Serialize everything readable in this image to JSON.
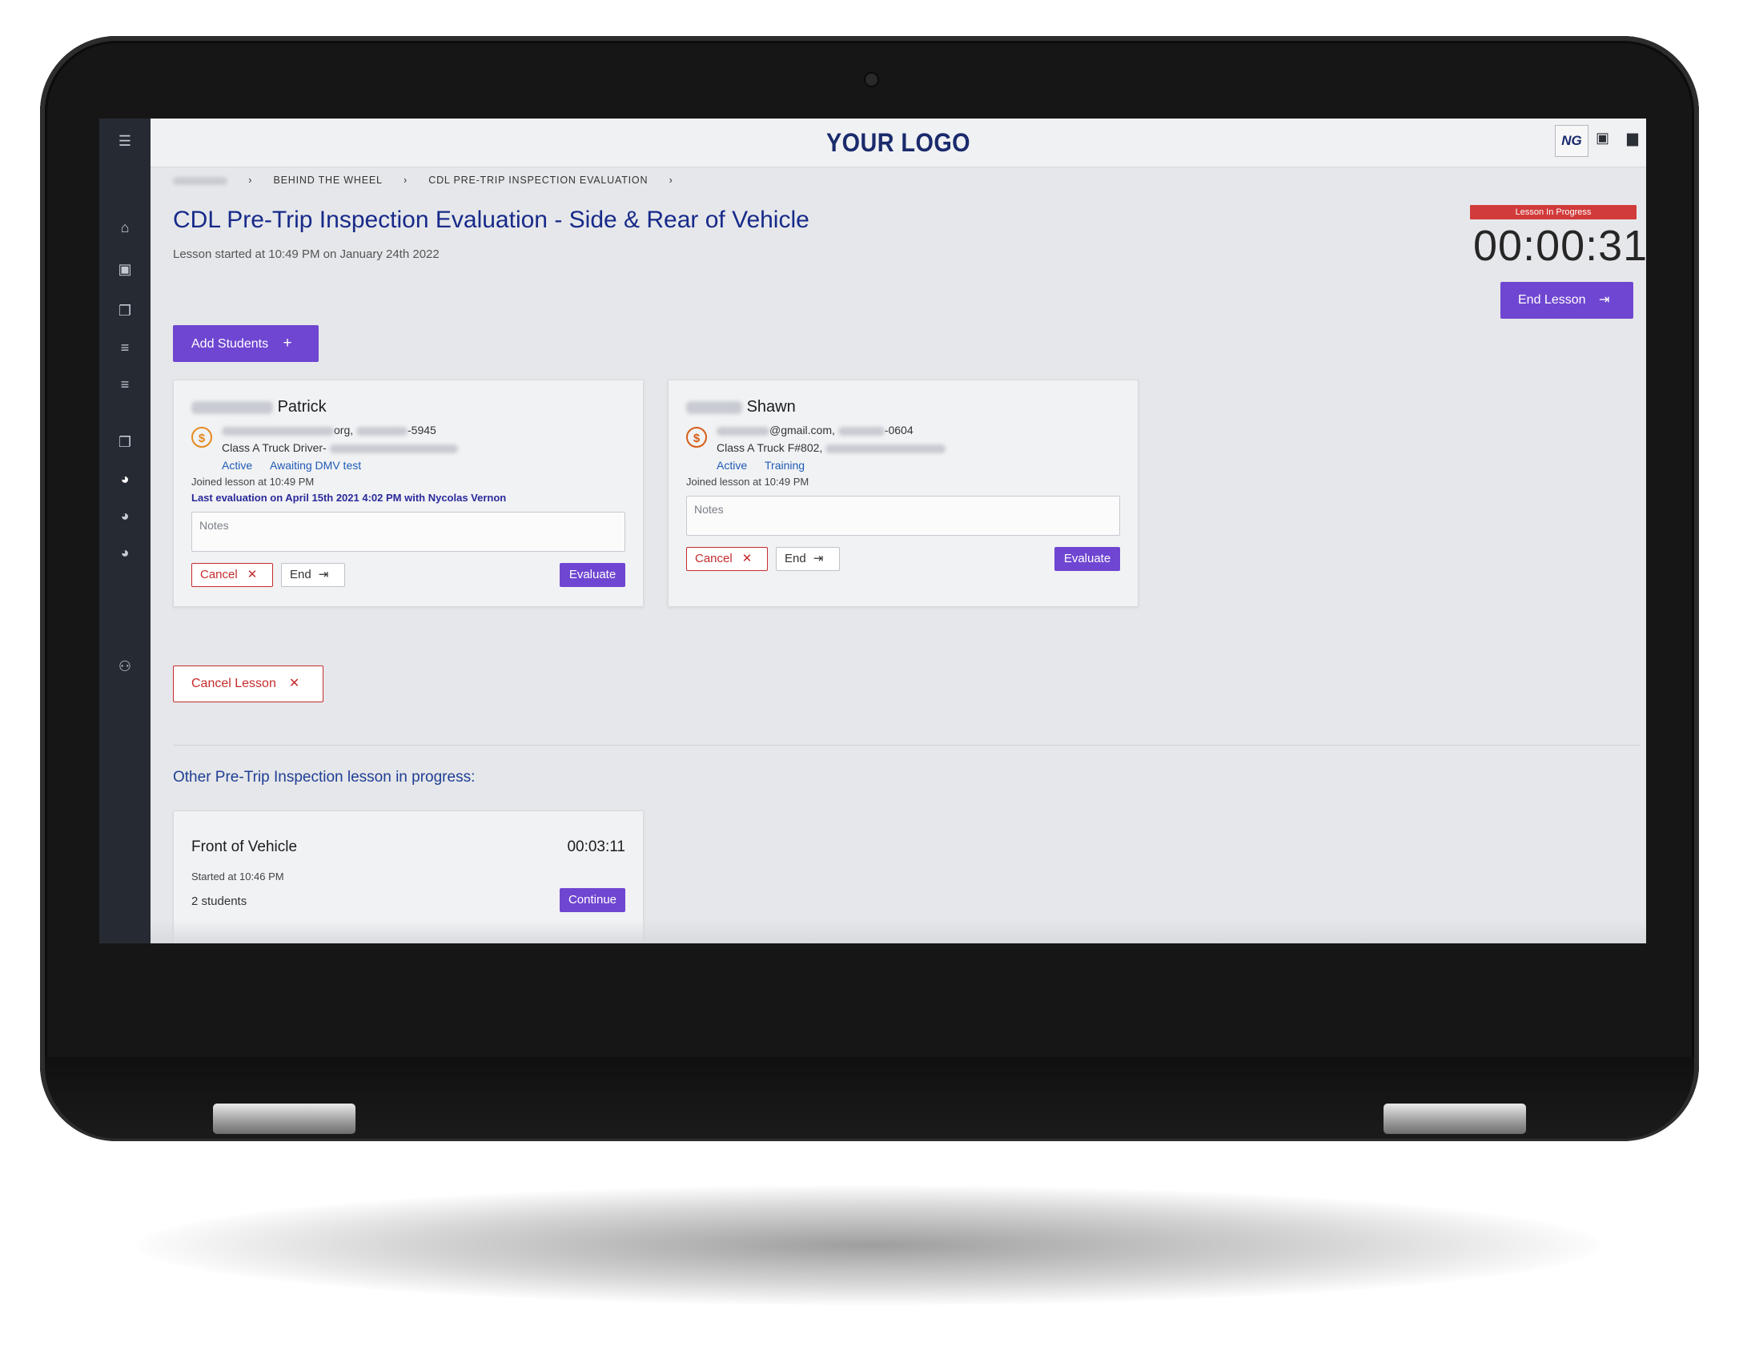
{
  "header": {
    "logo": "YOUR LOGO",
    "avatar_initials": "NG",
    "icons": [
      "menu-icon",
      "calendar-icon",
      "chat-icon"
    ]
  },
  "sidebar": {
    "icons": [
      "menu-icon",
      "home-icon",
      "calendar-icon",
      "copy-icon",
      "list-icon",
      "list-icon",
      "copy-icon",
      "chat-user-icon",
      "chat-user-icon",
      "chat-user-icon",
      "users-icon"
    ]
  },
  "breadcrumb": {
    "items": [
      "BEHIND THE WHEEL",
      "CDL PRE-TRIP INSPECTION EVALUATION"
    ],
    "separator": "›"
  },
  "page": {
    "title": "CDL Pre-Trip Inspection Evaluation - Side & Rear of Vehicle",
    "subtitle": "Lesson started at 10:49 PM on January 24th 2022"
  },
  "lesson_status": {
    "badge": "Lesson In Progress",
    "timer": "00:00:31",
    "end_button": "End Lesson"
  },
  "actions": {
    "add_students": "Add Students",
    "cancel_lesson": "Cancel Lesson"
  },
  "students": [
    {
      "first_name": "Patrick",
      "email_mid": "org,",
      "phone_suffix": "-5945",
      "class": "Class A Truck Driver-",
      "status": "Active",
      "stage": "Awaiting DMV test",
      "joined": "Joined lesson at 10:49 PM",
      "last_eval": "Last evaluation on April 15th 2021 4:02 PM with Nycolas Vernon",
      "notes_placeholder": "Notes",
      "cancel": "Cancel",
      "end": "End",
      "evaluate": "Evaluate"
    },
    {
      "first_name": "Shawn",
      "email_mid": "@gmail.com,",
      "phone_suffix": "-0604",
      "class": "Class A Truck F#802,",
      "status": "Active",
      "stage": "Training",
      "joined": "Joined lesson at 10:49 PM",
      "notes_placeholder": "Notes",
      "cancel": "Cancel",
      "end": "End",
      "evaluate": "Evaluate"
    }
  ],
  "other_lessons": {
    "heading": "Other Pre-Trip Inspection lesson in progress:",
    "items": [
      {
        "title": "Front of Vehicle",
        "timer": "00:03:11",
        "started": "Started at 10:46 PM",
        "students": "2 students",
        "button": "Continue"
      }
    ]
  },
  "colors": {
    "accent": "#6f46d1",
    "title": "#172a8a",
    "danger": "#c52c2c",
    "badge": "#d23b3b",
    "sidebar": "#262b33"
  }
}
